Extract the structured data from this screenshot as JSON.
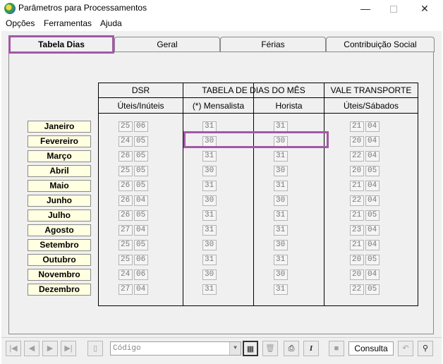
{
  "window": {
    "title": "Parâmetros para Processamentos",
    "minimize_glyph": "—",
    "close_glyph": "✕"
  },
  "menu": [
    {
      "label": "Opções"
    },
    {
      "label": "Ferramentas"
    },
    {
      "label": "Ajuda"
    }
  ],
  "tabs": [
    {
      "label": "Tabela Dias",
      "active": true
    },
    {
      "label": "Geral"
    },
    {
      "label": "Férias"
    },
    {
      "label": "Contribuição Social"
    }
  ],
  "table": {
    "groups": {
      "dsr": "DSR",
      "tabela": "TABELA DE DIAS DO MÊS",
      "vale": "VALE TRANSPORTE"
    },
    "subheaders": {
      "dsr": "Úteis/Inúteis",
      "mensalista": "(*) Mensalista",
      "horista": "Horista",
      "vale": "Úteis/Sábados"
    },
    "rows": [
      {
        "month": "Janeiro",
        "dsr_uteis": "25",
        "dsr_inuteis": "06",
        "mensalista": "31",
        "horista": "31",
        "vt_uteis": "21",
        "vt_sabados": "04"
      },
      {
        "month": "Fevereiro",
        "dsr_uteis": "24",
        "dsr_inuteis": "05",
        "mensalista": "30",
        "horista": "30",
        "vt_uteis": "20",
        "vt_sabados": "04"
      },
      {
        "month": "Março",
        "dsr_uteis": "26",
        "dsr_inuteis": "05",
        "mensalista": "31",
        "horista": "31",
        "vt_uteis": "22",
        "vt_sabados": "04"
      },
      {
        "month": "Abril",
        "dsr_uteis": "25",
        "dsr_inuteis": "05",
        "mensalista": "30",
        "horista": "30",
        "vt_uteis": "20",
        "vt_sabados": "05"
      },
      {
        "month": "Maio",
        "dsr_uteis": "26",
        "dsr_inuteis": "05",
        "mensalista": "31",
        "horista": "31",
        "vt_uteis": "21",
        "vt_sabados": "04"
      },
      {
        "month": "Junho",
        "dsr_uteis": "26",
        "dsr_inuteis": "04",
        "mensalista": "30",
        "horista": "30",
        "vt_uteis": "22",
        "vt_sabados": "04"
      },
      {
        "month": "Julho",
        "dsr_uteis": "26",
        "dsr_inuteis": "05",
        "mensalista": "31",
        "horista": "31",
        "vt_uteis": "21",
        "vt_sabados": "05"
      },
      {
        "month": "Agosto",
        "dsr_uteis": "27",
        "dsr_inuteis": "04",
        "mensalista": "31",
        "horista": "31",
        "vt_uteis": "23",
        "vt_sabados": "04"
      },
      {
        "month": "Setembro",
        "dsr_uteis": "25",
        "dsr_inuteis": "05",
        "mensalista": "30",
        "horista": "30",
        "vt_uteis": "21",
        "vt_sabados": "04"
      },
      {
        "month": "Outubro",
        "dsr_uteis": "25",
        "dsr_inuteis": "06",
        "mensalista": "31",
        "horista": "31",
        "vt_uteis": "20",
        "vt_sabados": "05"
      },
      {
        "month": "Novembro",
        "dsr_uteis": "24",
        "dsr_inuteis": "06",
        "mensalista": "30",
        "horista": "30",
        "vt_uteis": "20",
        "vt_sabados": "04"
      },
      {
        "month": "Dezembro",
        "dsr_uteis": "27",
        "dsr_inuteis": "04",
        "mensalista": "31",
        "horista": "31",
        "vt_uteis": "22",
        "vt_sabados": "05"
      }
    ]
  },
  "toolbar": {
    "first_icon": "first-record-icon",
    "prev_icon": "previous-record-icon",
    "next_icon": "next-record-icon",
    "last_icon": "last-record-icon",
    "combo_placeholder": "Código",
    "status": "Consulta",
    "italic_label": "I"
  },
  "colors": {
    "highlight": "#a358a7",
    "month_bg": "#ffffe1"
  }
}
